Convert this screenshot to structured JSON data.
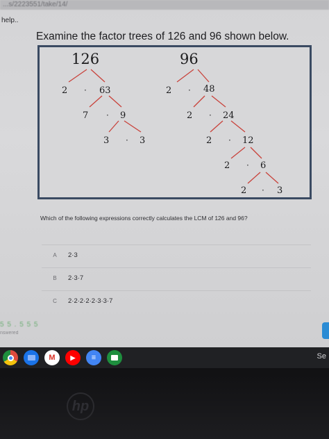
{
  "browser": {
    "url": "...s/2223551/take/14/"
  },
  "page": {
    "help_text": "help..",
    "question_title": "Examine the factor trees of 126 and 96 shown below.",
    "prompt": "Which of the following expressions correctly calculates the LCM of 126 and 96?",
    "progress_marks": "5 5 . 5 5 5",
    "answered_label": "nswered"
  },
  "tree_126": {
    "root": "126",
    "nodes": [
      "2",
      "63",
      "7",
      "9",
      "3",
      "3"
    ]
  },
  "tree_96": {
    "root": "96",
    "nodes": [
      "2",
      "48",
      "2",
      "24",
      "2",
      "12",
      "2",
      "6",
      "2",
      "3"
    ]
  },
  "choices": [
    {
      "letter": "A",
      "text": "2·3"
    },
    {
      "letter": "B",
      "text": "2·3·7"
    },
    {
      "letter": "C",
      "text": "2·2·2·2·2·3·3·7"
    }
  ],
  "shelf": {
    "apps": [
      {
        "name": "chrome-icon",
        "glyph": "",
        "color": "#dd4b3e"
      },
      {
        "name": "files-icon",
        "glyph": "",
        "color": "#1a73e8"
      },
      {
        "name": "gmail-icon",
        "glyph": "M",
        "color": "#ffffff"
      },
      {
        "name": "youtube-icon",
        "glyph": "▶",
        "color": "#ff0000"
      },
      {
        "name": "docs-icon",
        "glyph": "≡",
        "color": "#4285f4"
      },
      {
        "name": "classroom-icon",
        "glyph": "",
        "color": "#1e8e3e"
      }
    ],
    "right_label": "Se"
  },
  "colors": {
    "branch": "#c9423b",
    "frame": "#3a4a62"
  }
}
